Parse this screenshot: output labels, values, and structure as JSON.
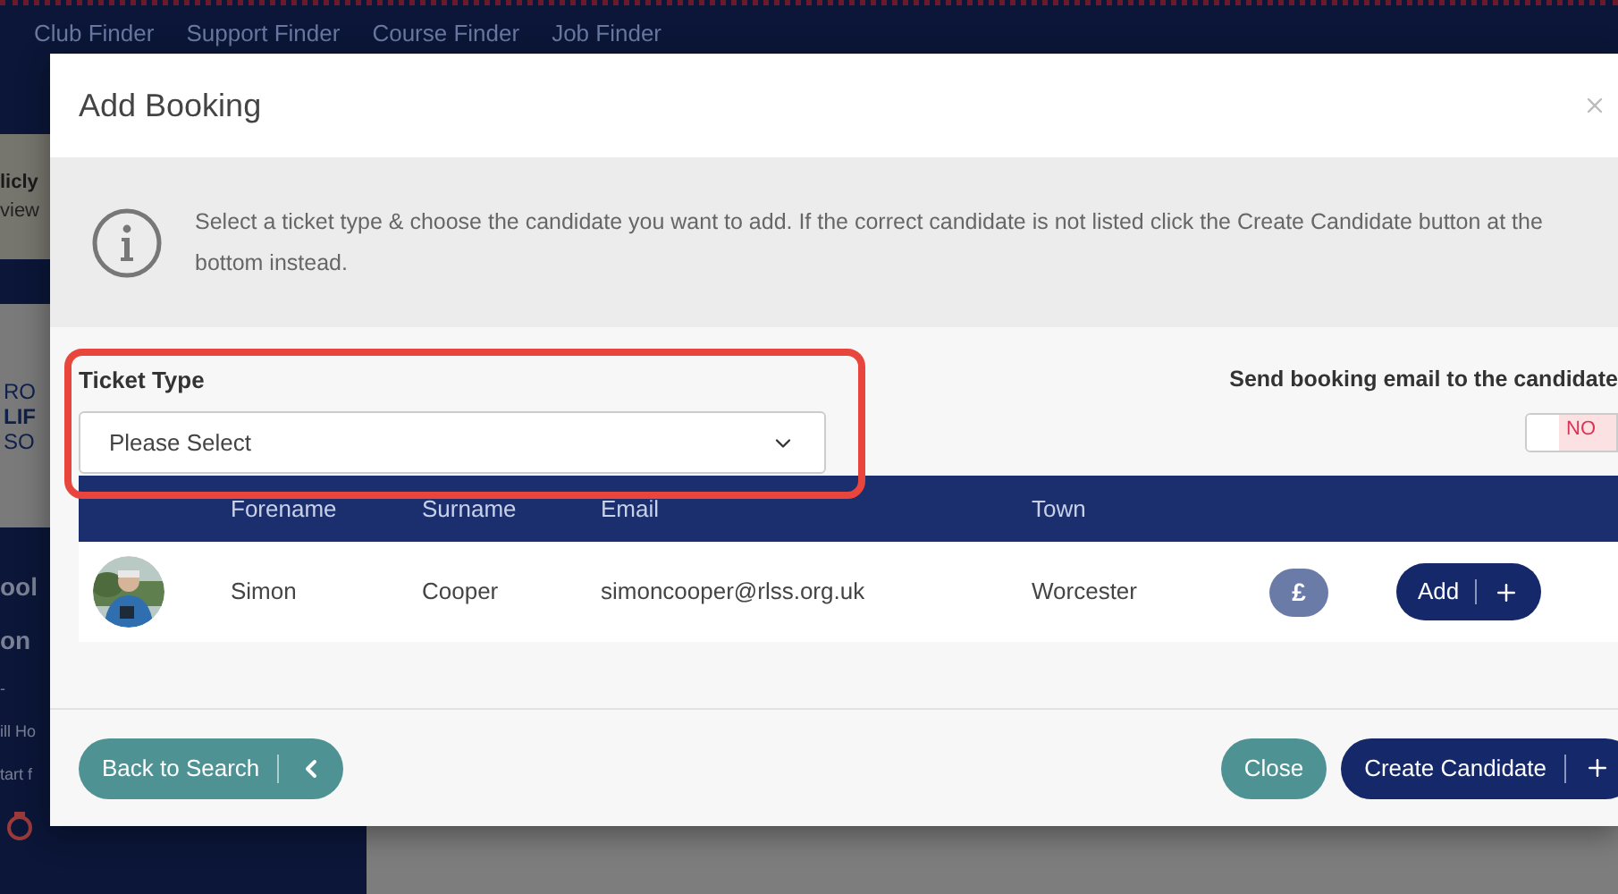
{
  "background": {
    "nav_links": [
      "Club Finder",
      "Support Finder",
      "Course Finder",
      "Job Finder"
    ],
    "banner": {
      "title": "licly",
      "subtitle": "view"
    },
    "logo": [
      "RO",
      "LIF",
      "SO"
    ],
    "sidebar_texts": [
      "ool",
      "on",
      "-",
      "ill Ho",
      "tart f"
    ]
  },
  "modal": {
    "title": "Add Booking",
    "info": "Select a ticket type & choose the candidate you want to add. If the correct candidate is not listed click the Create Candidate button at the bottom instead.",
    "ticket_type": {
      "label": "Ticket Type",
      "value": "Please Select",
      "highlighted": true
    },
    "email_toggle": {
      "label": "Send booking email to the candidate",
      "state_text": "NO",
      "on": false
    },
    "table": {
      "columns": [
        "Forename",
        "Surname",
        "Email",
        "Town"
      ],
      "rows": [
        {
          "forename": "Simon",
          "surname": "Cooper",
          "email": "simoncooper@rlss.org.uk",
          "town": "Worcester",
          "price_badge": "£",
          "action": "Add"
        }
      ]
    },
    "footer": {
      "back": "Back to Search",
      "close": "Close",
      "create": "Create Candidate"
    }
  }
}
